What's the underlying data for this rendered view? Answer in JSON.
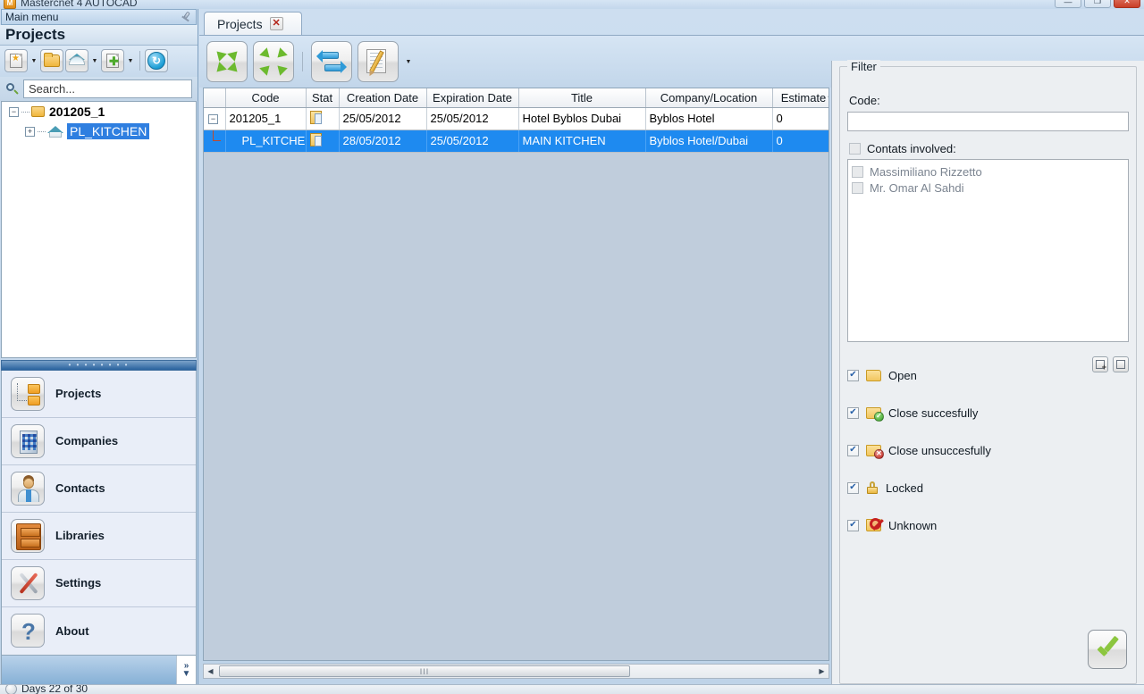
{
  "window": {
    "title": "Mastercnet 4 AUTOCAD",
    "app_icon": "app-icon",
    "minimize_label": "—",
    "maximize_label": "❐",
    "close_label": "✕"
  },
  "left_panel": {
    "main_menu_label": "Main menu",
    "pin_icon": "pin-icon",
    "title": "Projects",
    "toolbar": [
      {
        "name": "new-project-button",
        "icon": "new-page-icon"
      },
      {
        "name": "new-project-dropdown",
        "icon": "chevron-down-icon"
      },
      {
        "name": "open-folder-button",
        "icon": "folder-icon"
      },
      {
        "name": "roof-button",
        "icon": "roof-icon"
      },
      {
        "name": "roof-dropdown",
        "icon": "chevron-down-icon"
      },
      {
        "name": "add-button",
        "icon": "add-page-icon"
      },
      {
        "name": "add-dropdown",
        "icon": "chevron-down-icon"
      },
      {
        "name": "refresh-button",
        "icon": "refresh-icon"
      }
    ],
    "search": {
      "placeholder": "Search...",
      "value": "Search...",
      "icon": "search-icon"
    },
    "tree": [
      {
        "label": "201205_1",
        "expander": "−",
        "icon": "folder-icon",
        "selected": false
      },
      {
        "label": "PL_KITCHEN",
        "expander": "+",
        "icon": "roof-icon",
        "selected": true
      }
    ],
    "nav": [
      {
        "label": "Projects",
        "icon": "projects-icon"
      },
      {
        "label": "Companies",
        "icon": "building-icon"
      },
      {
        "label": "Contacts",
        "icon": "contact-icon"
      },
      {
        "label": "Libraries",
        "icon": "library-icon"
      },
      {
        "label": "Settings",
        "icon": "tools-icon"
      },
      {
        "label": "About",
        "icon": "question-icon"
      }
    ],
    "footer_expand_icon": "chevrons-right-icon",
    "grip_dots": "• • • • • • • •"
  },
  "statusbar": {
    "text": "Days 22 of 30",
    "icon": "clock-icon"
  },
  "main": {
    "tab": {
      "label": "Projects",
      "close_label": "✕"
    },
    "toolbar": [
      {
        "name": "expand-all-button",
        "icon": "expand-arrows-icon"
      },
      {
        "name": "collapse-all-button",
        "icon": "collapse-arrows-icon"
      },
      {
        "name": "refresh-button",
        "icon": "sync-arrows-icon"
      },
      {
        "name": "edit-notes-button",
        "icon": "notepad-pencil-icon"
      },
      {
        "name": "edit-notes-dropdown",
        "icon": "chevron-down-icon"
      }
    ],
    "grid": {
      "columns": [
        "Code",
        "Stat",
        "Creation Date",
        "Expiration Date",
        "Title",
        "Company/Location",
        "Estimate"
      ],
      "sorted_column": "Estimate",
      "rows": [
        {
          "expander": "−",
          "level": 0,
          "selected": false,
          "code": "201205_1",
          "stat_icon": "document-status-icon",
          "creation_date": "25/05/2012",
          "expiration_date": "25/05/2012",
          "title": "Hotel Byblos Dubai",
          "company": "Byblos Hotel",
          "estimate": "0"
        },
        {
          "expander": "",
          "level": 1,
          "selected": true,
          "code": "PL_KITCHEN",
          "stat_icon": "document-status-icon",
          "creation_date": "28/05/2012",
          "expiration_date": "25/05/2012",
          "title": "MAIN KITCHEN",
          "company": "Byblos Hotel/Dubai",
          "estimate": "0"
        }
      ]
    },
    "hscroll": {
      "left_arrow": "◀",
      "right_arrow": "▶",
      "thumb_grip": "III"
    }
  },
  "filter": {
    "legend": "Filter",
    "code_label": "Code:",
    "code_value": "",
    "contacts_checkbox": {
      "label": "Contats involved:",
      "checked": false
    },
    "contacts": [
      {
        "label": "Massimiliano Rizzetto",
        "checked": false
      },
      {
        "label": "Mr. Omar Al Sahdi",
        "checked": false
      }
    ],
    "statuses": [
      {
        "label": "Open",
        "checked": true,
        "icon": "folder-open-icon",
        "check": "✔"
      },
      {
        "label": "Close succesfully",
        "checked": true,
        "icon": "folder-check-icon",
        "check": "✔"
      },
      {
        "label": "Close unsuccesfully",
        "checked": true,
        "icon": "folder-error-icon",
        "check": "✔"
      },
      {
        "label": "Locked",
        "checked": true,
        "icon": "lock-icon",
        "check": "✔"
      },
      {
        "label": "Unknown",
        "checked": true,
        "icon": "folder-forbidden-icon",
        "check": "✔"
      }
    ],
    "check_all_button": "check-all-icon",
    "uncheck_all_button": "uncheck-all-icon",
    "apply_button": "checkmark-icon"
  }
}
